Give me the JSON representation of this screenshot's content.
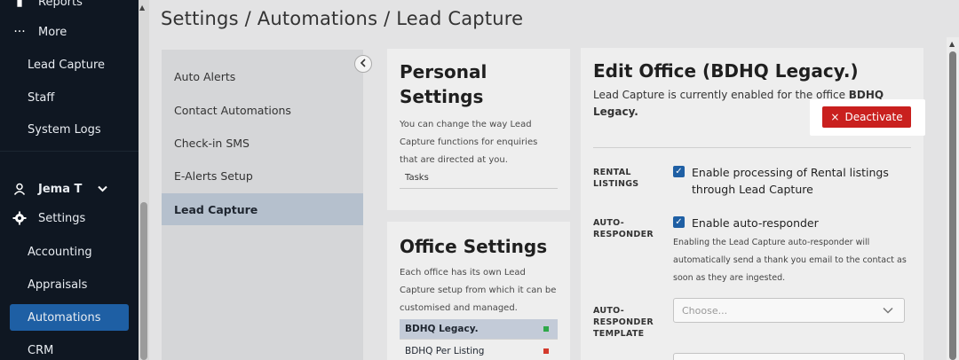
{
  "sidebar": {
    "items": [
      {
        "label": "Reports",
        "icon": "bar-chart-icon"
      },
      {
        "label": "More",
        "icon": "more-icon"
      },
      {
        "label": "Lead Capture"
      },
      {
        "label": "Staff"
      },
      {
        "label": "System Logs"
      },
      {
        "label": "Jema T",
        "icon": "user-icon"
      },
      {
        "label": "Settings",
        "icon": "gear-icon"
      },
      {
        "label": "Accounting"
      },
      {
        "label": "Appraisals"
      },
      {
        "label": "Automations"
      },
      {
        "label": "CRM"
      }
    ]
  },
  "header": {
    "breadcrumb": "Settings / Automations / Lead Capture"
  },
  "menu": {
    "items": [
      "Auto Alerts",
      "Contact Automations",
      "Check-in SMS",
      "E-Alerts Setup",
      "Lead Capture"
    ]
  },
  "personal": {
    "title": "Personal Settings",
    "desc": "You can change the way Lead Capture functions for enquiries that are directed at you.",
    "task": "Tasks"
  },
  "office": {
    "title": "Office Settings",
    "desc": "Each office has its own Lead Capture setup from which it can be customised and managed.",
    "rows": [
      {
        "name": "BDHQ Legacy.",
        "status_color": "#2ea84a"
      },
      {
        "name": "BDHQ Per Listing",
        "status_color": "#d33a2c"
      }
    ]
  },
  "edit": {
    "title": "Edit Office (BDHQ Legacy.)",
    "desc_prefix": "Lead Capture is currently enabled for the office ",
    "desc_office": "BDHQ Legacy.",
    "deactivate_label": "Deactivate",
    "rental_label_1": "RENTAL",
    "rental_label_2": "LISTINGS",
    "rental_option": "Enable processing of Rental listings through Lead Capture",
    "auto_label_1": "AUTO-",
    "auto_label_2": "RESPONDER",
    "auto_option": "Enable auto-responder",
    "auto_help": "Enabling the Lead Capture auto-responder will automatically send a thank you email to the contact as soon as they are ingested.",
    "template_label_1": "AUTO-",
    "template_label_2": "RESPONDER",
    "template_label_3": "TEMPLATE",
    "template_placeholder": "Choose..."
  },
  "colors": {
    "accent": "#1e5fa4",
    "danger": "#c9201e",
    "sidebar_bg": "#0f1722"
  }
}
